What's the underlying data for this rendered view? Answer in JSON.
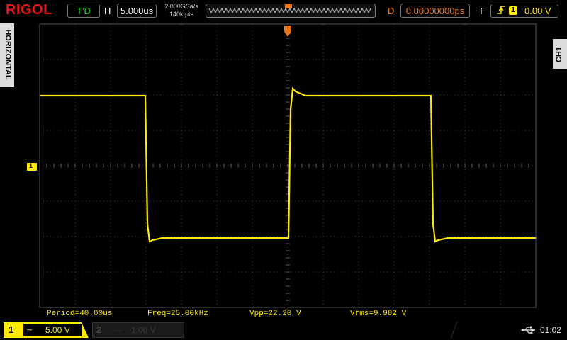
{
  "header": {
    "logo": "RIGOL",
    "run_status": "T'D",
    "timebase_label": "H",
    "timebase_value": "5.000us",
    "sample_rate": "2.000GSa/s",
    "memory_depth": "140k pts",
    "delay_label": "D",
    "delay_value": "0.00000000ps",
    "trigger_label": "T",
    "trigger_channel": "1",
    "trigger_level": "0.00 V"
  },
  "side_tabs": {
    "left": "HORIZONTAL",
    "right": "CH1"
  },
  "measurements": [
    {
      "label": "Period=40.00us"
    },
    {
      "label": "Freq=25.00kHz"
    },
    {
      "label": "Vpp=22.20 V"
    },
    {
      "label": "Vrms=9.982 V"
    }
  ],
  "channels": {
    "ch1": {
      "number": "1",
      "coupling": "~",
      "scale": "5.00 V"
    },
    "ch2": {
      "number": "2",
      "coupling": "---",
      "scale": "1.00 V"
    }
  },
  "ground_marker": "1",
  "clock": "01:02",
  "icons": {
    "trigger_edge": "rising-edge-icon",
    "usb": "usb-icon"
  },
  "colors": {
    "ch1": "#ffea00",
    "delay": "#e8781e",
    "logo": "#e01818",
    "status": "#2ecc2e"
  },
  "waveform": {
    "type": "square",
    "period_us": 40.0,
    "frequency_khz": 25.0,
    "vpp_v": 22.2,
    "vrms_v": 9.982
  }
}
